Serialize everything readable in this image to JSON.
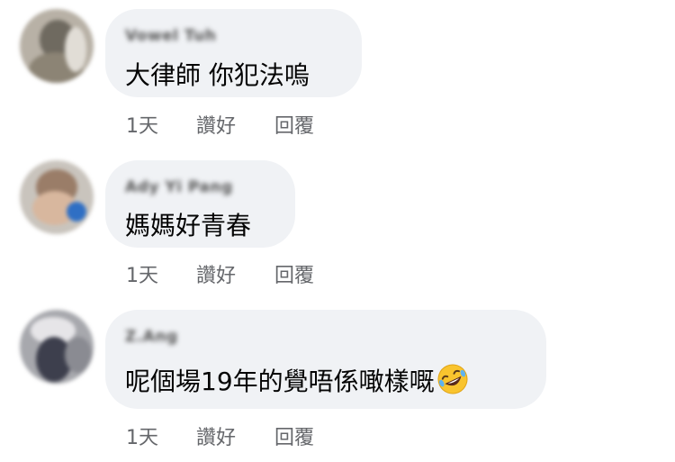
{
  "comments": [
    {
      "author": "Vowel Tuh",
      "text": "大律師 你犯法嗚",
      "time": "1天",
      "like_label": "讚好",
      "reply_label": "回覆"
    },
    {
      "author": "Ady Yi Pang",
      "text": "媽媽好青春",
      "time": "1天",
      "like_label": "讚好",
      "reply_label": "回覆"
    },
    {
      "author": "Z.Ang",
      "text": "呢個場19年的覺唔係噉樣嘅",
      "emoji": "rolling-on-the-floor-laughing",
      "time": "1天",
      "like_label": "讚好",
      "reply_label": "回覆"
    }
  ]
}
